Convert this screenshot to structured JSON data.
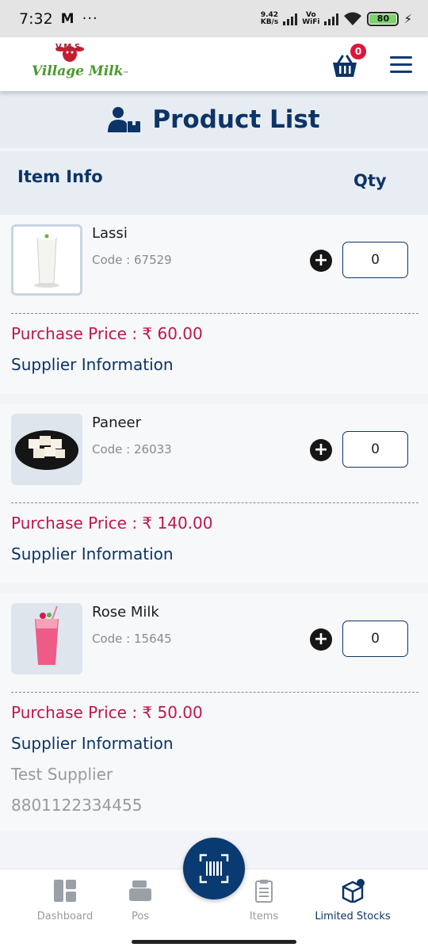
{
  "status_bar": {
    "time": "7:32",
    "mail_icon_label": "M",
    "more": "···",
    "net_speed_value": "9.42",
    "net_speed_unit": "KB/s",
    "vowifi_top": "Vo",
    "vowifi_bottom": "WiFi",
    "battery": "80"
  },
  "header": {
    "logo_top": "V.M.S",
    "logo_text": "Village Milk",
    "logo_tm": "™",
    "cart_count": "0"
  },
  "page": {
    "title": "Product List",
    "col_item_info": "Item Info",
    "col_qty": "Qty"
  },
  "products": [
    {
      "name": "Lassi",
      "code": "Code : 67529",
      "qty": "0",
      "price": "Purchase Price : ₹ 60.00",
      "supplier_label": "Supplier Information"
    },
    {
      "name": "Paneer",
      "code": "Code : 26033",
      "qty": "0",
      "price": "Purchase Price : ₹ 140.00",
      "supplier_label": "Supplier Information"
    },
    {
      "name": "Rose Milk",
      "code": "Code : 15645",
      "qty": "0",
      "price": "Purchase Price : ₹ 50.00",
      "supplier_label": "Supplier Information",
      "supplier_name": "Test Supplier",
      "supplier_phone": "8801122334455"
    }
  ],
  "nav": {
    "dashboard": "Dashboard",
    "pos": "Pos",
    "items": "Items",
    "limited_stocks": "Limited Stocks"
  },
  "colors": {
    "primary": "#0c3466",
    "price": "#c0154a",
    "badge": "#e0153a"
  }
}
